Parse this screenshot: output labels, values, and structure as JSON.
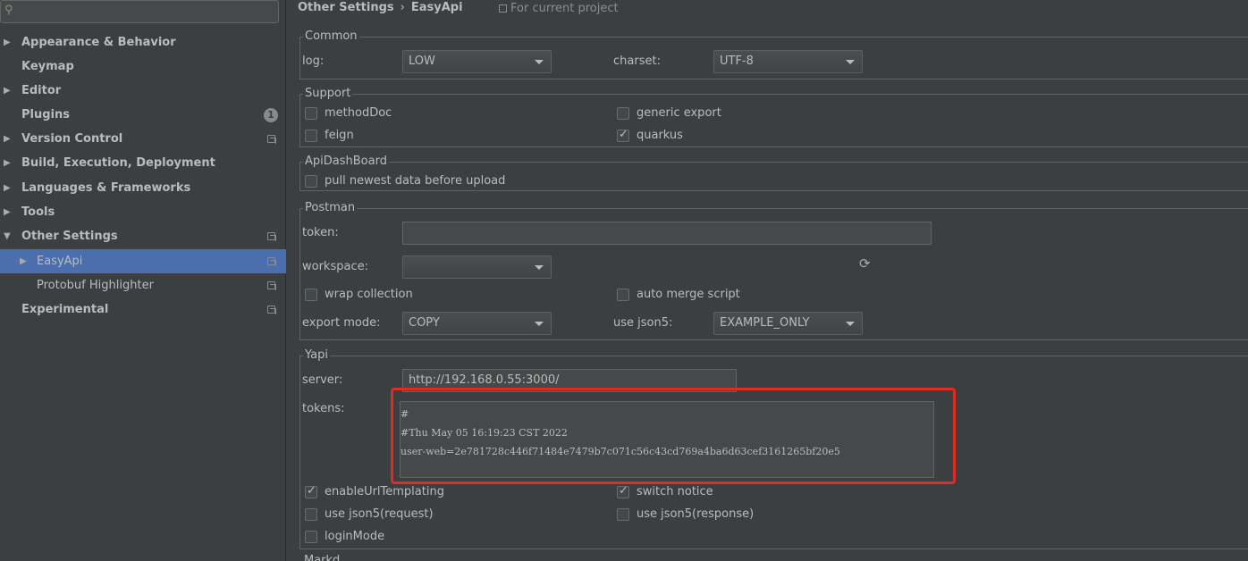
{
  "sidebar": {
    "search_placeholder": "",
    "items": [
      {
        "label": "Appearance & Behavior",
        "arrow": "▶"
      },
      {
        "label": "Keymap",
        "arrow": ""
      },
      {
        "label": "Editor",
        "arrow": "▶"
      },
      {
        "label": "Plugins",
        "arrow": "",
        "badge": "1"
      },
      {
        "label": "Version Control",
        "arrow": "▶"
      },
      {
        "label": "Build, Execution, Deployment",
        "arrow": "▶"
      },
      {
        "label": "Languages & Frameworks",
        "arrow": "▶"
      },
      {
        "label": "Tools",
        "arrow": "▶"
      },
      {
        "label": "Other Settings",
        "arrow": "▼"
      },
      {
        "label": "EasyApi",
        "arrow": "▶"
      },
      {
        "label": "Protobuf Highlighter",
        "arrow": ""
      },
      {
        "label": "Experimental",
        "arrow": ""
      }
    ]
  },
  "header": {
    "crumb1": "Other Settings",
    "sep": "›",
    "crumb2": "EasyApi",
    "scope": "For current project"
  },
  "common": {
    "title": "Common",
    "log_label": "log:",
    "log_value": "LOW",
    "charset_label": "charset:",
    "charset_value": "UTF-8"
  },
  "support": {
    "title": "Support",
    "methodDoc": "methodDoc",
    "generic_export": "generic export",
    "feign": "feign",
    "quarkus": "quarkus"
  },
  "dashboard": {
    "title": "ApiDashBoard",
    "pull": "pull newest data before upload"
  },
  "postman": {
    "title": "Postman",
    "token_label": "token:",
    "token_value": "",
    "workspace_label": "workspace:",
    "workspace_value": "",
    "wrap_collection": "wrap collection",
    "auto_merge": "auto merge script",
    "export_mode_label": "export mode:",
    "export_mode_value": "COPY",
    "use_json5_label": "use json5:",
    "use_json5_value": "EXAMPLE_ONLY"
  },
  "yapi": {
    "title": "Yapi",
    "server_label": "server:",
    "server_value": "http://192.168.0.55:3000/",
    "tokens_label": "tokens:",
    "tokens_lines": [
      "#",
      "#Thu May 05 16:19:23 CST 2022",
      "user-web=2e781728c446f71484e7479b7c071c56c43cd769a4ba6d63cef3161265bf20e5"
    ],
    "enableUrlTemplating": "enableUrlTemplating",
    "switch_notice": "switch notice",
    "use_json5_request": "use json5(request)",
    "use_json5_response": "use json5(response)",
    "loginMode": "loginMode"
  },
  "module_cut": "Markd",
  "colors": {
    "background": "#3c3f41",
    "selection": "#4b6eaf",
    "highlight": "#e02b20"
  }
}
